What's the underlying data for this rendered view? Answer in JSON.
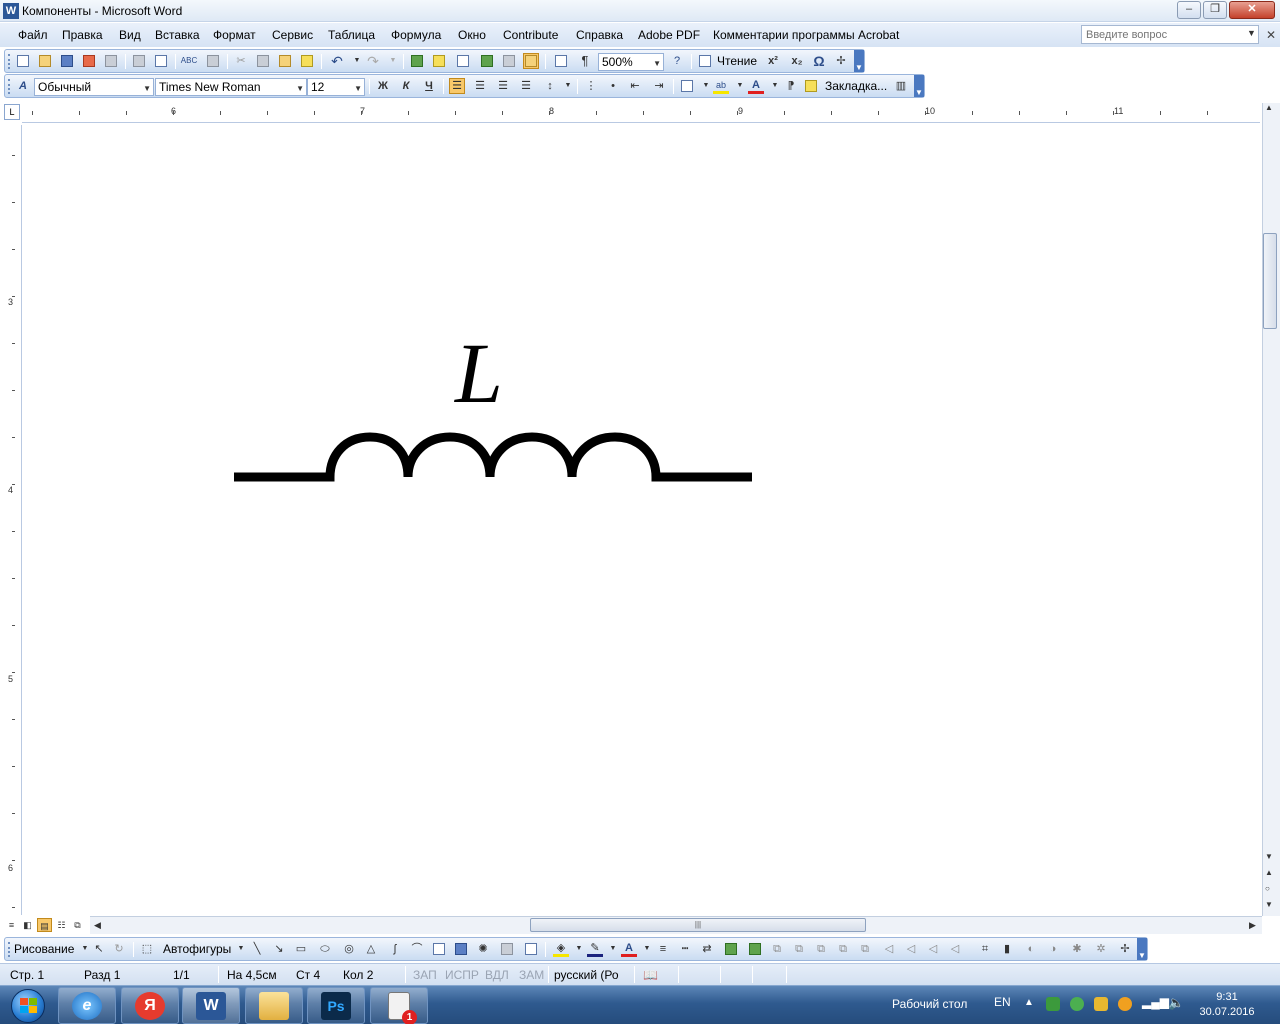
{
  "window": {
    "title": "Компоненты - Microsoft Word",
    "app_icon": "word-icon",
    "controls": [
      "minimize",
      "maximize",
      "close"
    ]
  },
  "menu": {
    "items": [
      "Файл",
      "Правка",
      "Вид",
      "Вставка",
      "Формат",
      "Сервис",
      "Таблица",
      "Формула",
      "Окно",
      "Contribute",
      "Справка",
      "Adobe PDF",
      "Комментарии программы Acrobat"
    ],
    "help_placeholder": "Введите вопрос"
  },
  "standard_toolbar": {
    "zoom": "500%",
    "reading_label": "Чтение",
    "superscript": "x²",
    "subscript": "x₂",
    "omega": "Ω",
    "pilcrow": "¶"
  },
  "format_toolbar": {
    "style": "Обычный",
    "font": "Times New Roman",
    "size": "12",
    "bold": "Ж",
    "italic": "К",
    "underline": "Ч",
    "bookmark_label": "Закладка..."
  },
  "ruler": {
    "horizontal_numbers": [
      "6",
      "7",
      "8",
      "9",
      "10",
      "11"
    ],
    "vertical_numbers": [
      "3",
      "4",
      "5",
      "6"
    ],
    "tab_stop_symbol": "L"
  },
  "document": {
    "inductor_label": "L"
  },
  "drawing_toolbar": {
    "draw_label": "Рисование",
    "autoshapes_label": "Автофигуры"
  },
  "status": {
    "page": "Стр. 1",
    "section": "Разд 1",
    "pages": "1/1",
    "at": "На 4,5см",
    "line": "Ст 4",
    "col": "Кол 2",
    "rec": "ЗАП",
    "trk": "ИСПР",
    "ext": "ВДЛ",
    "ovr": "ЗАМ",
    "language": "русский (Ро"
  },
  "taskbar": {
    "apps": [
      "internet-explorer",
      "yandex-browser",
      "microsoft-word",
      "file-explorer",
      "photoshop",
      "notification-document"
    ],
    "desktop_label": "Рабочий стол",
    "lang": "EN",
    "time": "9:31",
    "date": "30.07.2016",
    "notification_count": "1",
    "yandex_letter": "Я",
    "photoshop_letters": "Ps"
  },
  "colors": {
    "menu_bg": "#dbe7f6",
    "toolbar_bg": "#cadcf2",
    "taskbar_bg": "#2f5a8f",
    "active_button": "#f8c86a"
  }
}
